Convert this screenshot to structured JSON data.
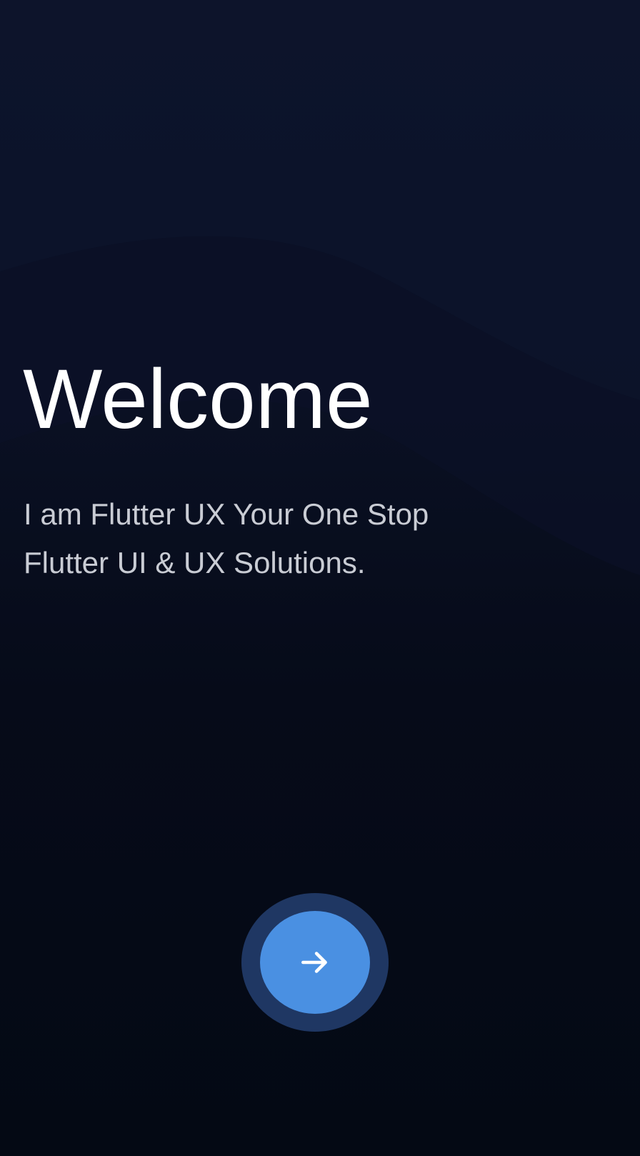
{
  "welcome": {
    "title": "Welcome",
    "tagline_line1": "I am Flutter UX Your One Stop",
    "tagline_line2": "Flutter UI & UX Solutions."
  },
  "next_button": {
    "icon": "arrow-right-icon"
  },
  "colors": {
    "background_top": "#0c1227",
    "background_bottom": "#040914",
    "button_ring": "#1f3763",
    "button_fill": "#4a90e2",
    "title_text": "#ffffff",
    "tagline_text": "#c9ccd4"
  }
}
